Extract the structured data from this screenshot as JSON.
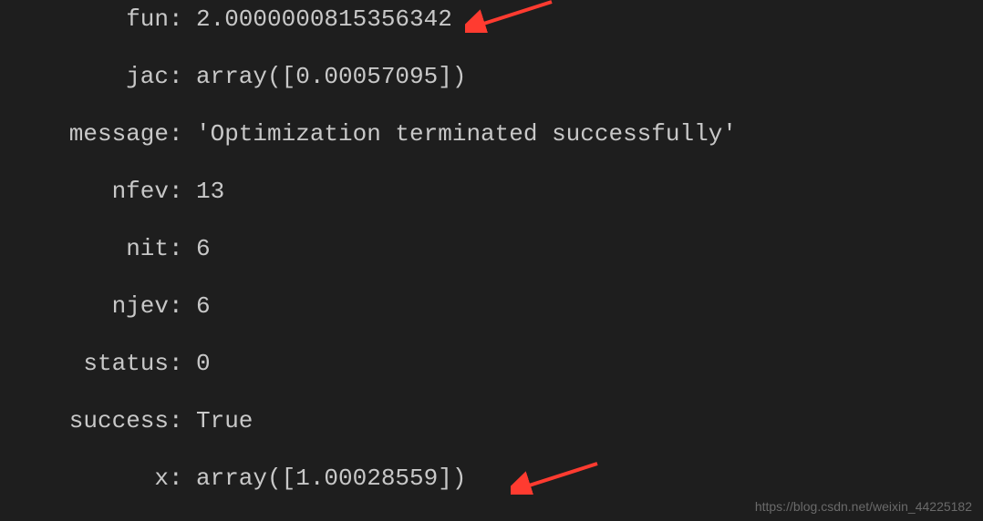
{
  "output": {
    "rows": [
      {
        "key": "fun",
        "value": "2.0000000815356342"
      },
      {
        "key": "jac",
        "value": "array([0.00057095])"
      },
      {
        "key": "message",
        "value": "'Optimization terminated successfully'"
      },
      {
        "key": "nfev",
        "value": "13"
      },
      {
        "key": "nit",
        "value": "6"
      },
      {
        "key": "njev",
        "value": "6"
      },
      {
        "key": "status",
        "value": "0"
      },
      {
        "key": "success",
        "value": "True"
      },
      {
        "key": "x",
        "value": "array([1.00028559])"
      }
    ]
  },
  "watermark": "https://blog.csdn.net/weixin_44225182"
}
